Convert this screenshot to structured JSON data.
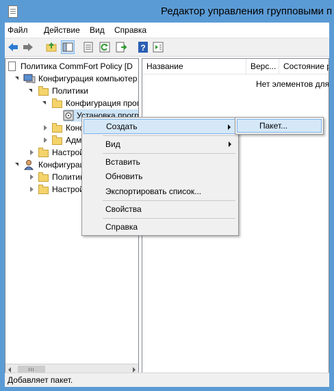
{
  "window": {
    "title": "Редактор управления групповыми п",
    "accent": "#5b9bd5"
  },
  "menubar": {
    "items": [
      "Файл",
      "Действие",
      "Вид",
      "Справка"
    ]
  },
  "toolbar": {
    "buttons": [
      "back-icon",
      "forward-icon",
      "up-folder-icon",
      "show-hide-tree-icon",
      "properties-icon",
      "refresh-icon",
      "export-list-icon",
      "help-icon",
      "show-action-pane-icon"
    ]
  },
  "tree": {
    "items": [
      {
        "label": "Политика CommFort Policy [D",
        "icon": "policy-doc-icon",
        "expanded": true
      },
      {
        "label": "Конфигурация компьютер",
        "icon": "computer-icon",
        "expanded": true
      },
      {
        "label": "Политики",
        "icon": "folder-icon",
        "expanded": true
      },
      {
        "label": "Конфигурация прог",
        "icon": "folder-icon",
        "expanded": true
      },
      {
        "label": "Установка прогр",
        "icon": "software-install-icon",
        "selected": true
      },
      {
        "label": "Конф",
        "icon": "folder-icon",
        "expanded": false
      },
      {
        "label": "Адми",
        "icon": "folder-icon",
        "expanded": false
      },
      {
        "label": "Настрой",
        "icon": "folder-icon",
        "expanded": false
      },
      {
        "label": "Конфигурация",
        "icon": "user-icon",
        "expanded": true
      },
      {
        "label": "Политик",
        "icon": "folder-icon",
        "expanded": false
      },
      {
        "label": "Настрой",
        "icon": "folder-icon",
        "expanded": false
      }
    ]
  },
  "list": {
    "columns": [
      "Название",
      "Верс...",
      "Состояние ра"
    ],
    "empty_message": "Нет элементов для о"
  },
  "context_menu": {
    "items": [
      {
        "label": "Создать",
        "submenu": true,
        "highlighted": true
      },
      {
        "label": "Вид",
        "submenu": true
      },
      {
        "label": "Вставить"
      },
      {
        "label": "Обновить"
      },
      {
        "label": "Экспортировать список..."
      },
      {
        "label": "Свойства"
      },
      {
        "label": "Справка"
      }
    ],
    "submenu_item": "Пакет..."
  },
  "status": {
    "text": "Добавляет пакет."
  }
}
